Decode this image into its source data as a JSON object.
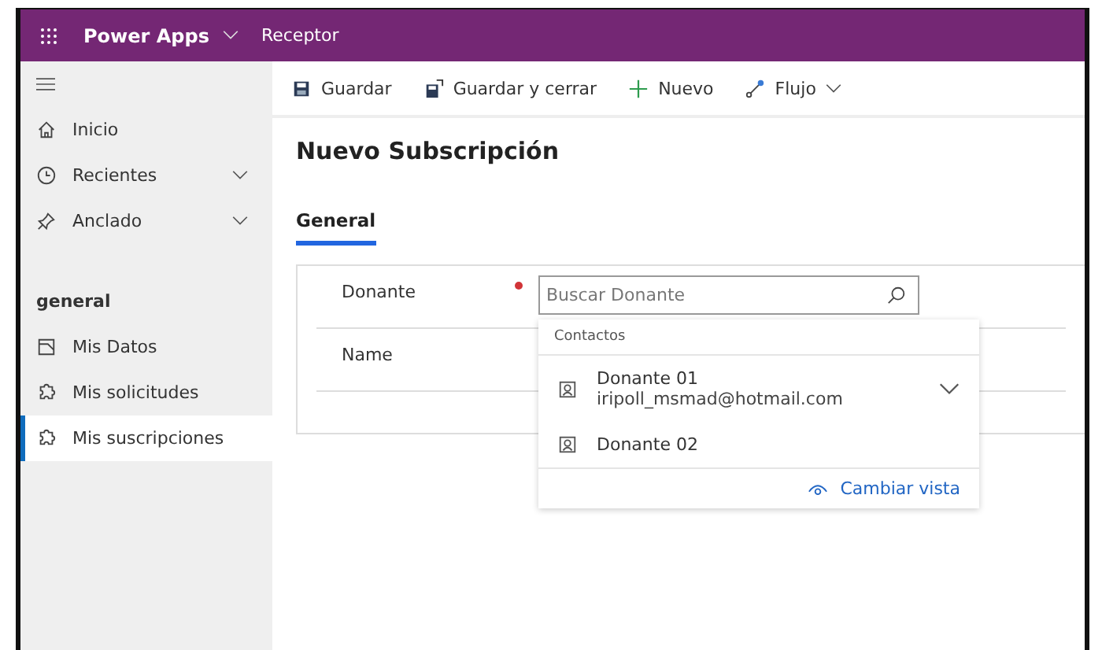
{
  "header": {
    "app_name": "Power Apps",
    "area": "Receptor"
  },
  "sidebar": {
    "top_items": [
      {
        "label": "Inicio",
        "kind": "home",
        "expandable": false
      },
      {
        "label": "Recientes",
        "kind": "clock",
        "expandable": true
      },
      {
        "label": "Anclado",
        "kind": "pin",
        "expandable": true
      }
    ],
    "group_label": "general",
    "items": [
      {
        "label": "Mis Datos",
        "kind": "doc",
        "selected": false
      },
      {
        "label": "Mis solicitudes",
        "kind": "puzzle",
        "selected": false
      },
      {
        "label": "Mis suscripciones",
        "kind": "puzzle",
        "selected": true
      }
    ]
  },
  "toolbar": [
    {
      "label": "Guardar",
      "kind": "save",
      "menu": false
    },
    {
      "label": "Guardar y cerrar",
      "kind": "saveclose",
      "menu": false
    },
    {
      "label": "Nuevo",
      "kind": "plus",
      "menu": false
    },
    {
      "label": "Flujo",
      "kind": "flow",
      "menu": true
    }
  ],
  "form": {
    "title": "Nuevo Subscripción",
    "tabs": [
      {
        "label": "General",
        "selected": true
      }
    ],
    "fields": [
      {
        "label": "Donante",
        "required": true,
        "placeholder": "Buscar Donante"
      },
      {
        "label": "Name",
        "required": false
      }
    ]
  },
  "lookup": {
    "section": "Contactos",
    "results": [
      {
        "name": "Donante 01",
        "detail": "iripoll_msmad@hotmail.com",
        "expandable": true
      },
      {
        "name": "Donante 02",
        "expandable": false
      }
    ],
    "change_view": "Cambiar vista"
  }
}
